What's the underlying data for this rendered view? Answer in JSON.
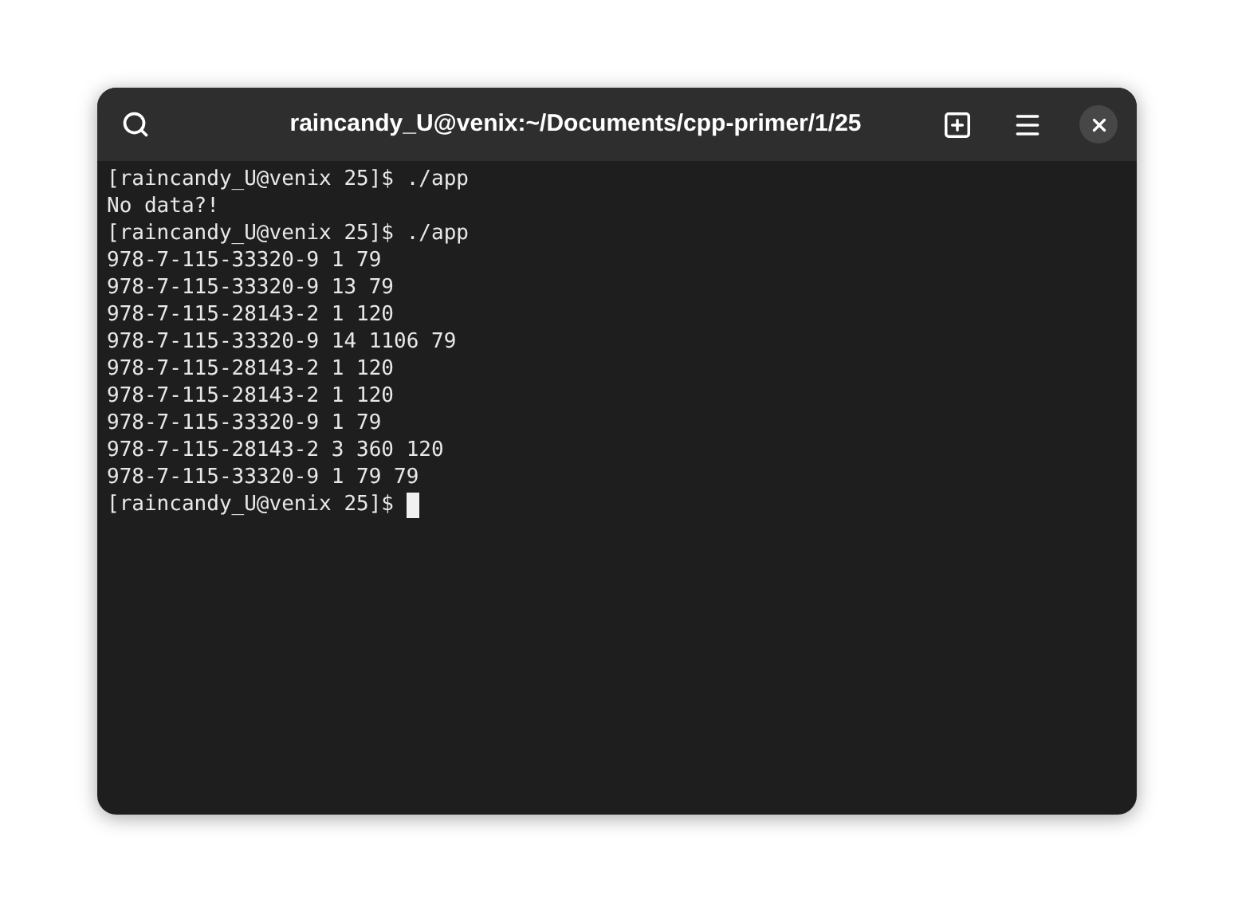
{
  "window": {
    "title": "raincandy_U@venix:~/Documents/cpp-primer/1/25"
  },
  "terminal": {
    "lines": [
      "[raincandy_U@venix 25]$ ./app",
      "No data?!",
      "[raincandy_U@venix 25]$ ./app",
      "978-7-115-33320-9 1 79",
      "978-7-115-33320-9 13 79",
      "978-7-115-28143-2 1 120",
      "978-7-115-33320-9 14 1106 79",
      "978-7-115-28143-2 1 120",
      "978-7-115-28143-2 1 120",
      "978-7-115-33320-9 1 79",
      "978-7-115-28143-2 3 360 120",
      "978-7-115-33320-9 1 79 79",
      "[raincandy_U@venix 25]$"
    ],
    "cursor": true
  }
}
